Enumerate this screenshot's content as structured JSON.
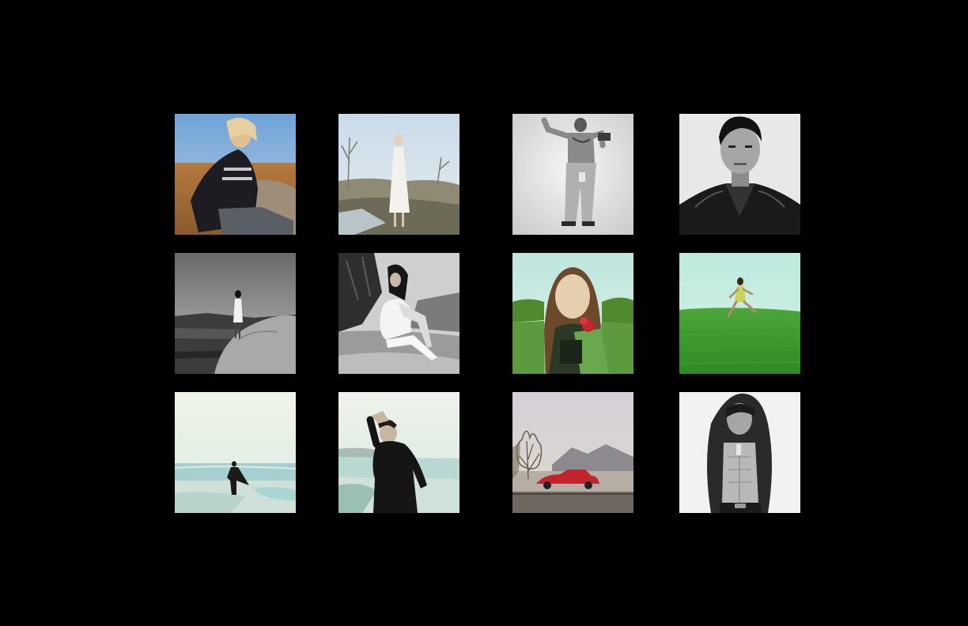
{
  "page": {
    "background": "#000000"
  },
  "gallery": {
    "thumbnails": [
      {
        "subject": "model-reclining-desert-leather-jacket",
        "palette": "warm-color"
      },
      {
        "subject": "woman-white-dress-field",
        "palette": "pale-color"
      },
      {
        "subject": "shirtless-man-back-tattoos",
        "palette": "black-and-white"
      },
      {
        "subject": "man-leather-jacket-portrait",
        "palette": "black-and-white"
      },
      {
        "subject": "woman-standing-on-rocks",
        "palette": "black-and-white"
      },
      {
        "subject": "woman-seated-on-rocks",
        "palette": "black-and-white"
      },
      {
        "subject": "woman-with-red-flower-road",
        "palette": "green-tint"
      },
      {
        "subject": "woman-running-green-field",
        "palette": "green-tint"
      },
      {
        "subject": "figure-walking-beach",
        "palette": "cyan-tint"
      },
      {
        "subject": "man-black-coat-beach",
        "palette": "cyan-tint"
      },
      {
        "subject": "red-car-desert-road",
        "palette": "muted-color"
      },
      {
        "subject": "man-open-hoodie",
        "palette": "black-and-white"
      }
    ]
  }
}
